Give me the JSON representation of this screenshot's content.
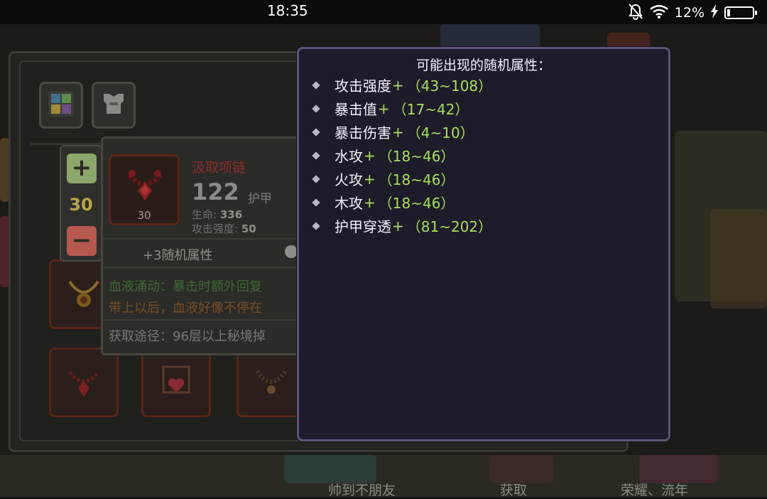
{
  "status_bar": {
    "time": "18:35",
    "battery_percent": "12%",
    "battery_level": 0.12,
    "icons": [
      "bell-off-icon",
      "wifi-icon",
      "charging-bolt-icon",
      "battery-icon"
    ]
  },
  "equipment_panel": {
    "tabs": [
      {
        "icon": "grid-inventory-icon"
      },
      {
        "icon": "armor-icon"
      }
    ],
    "slot_icons": [
      "necklace-gold-icon",
      "necklace-red-icon",
      "necklace-heart-icon",
      "necklace-bead-icon"
    ]
  },
  "stepper": {
    "plus": "+",
    "value": "30",
    "minus": "−"
  },
  "item_card": {
    "name": "汲取项链",
    "armor_value": "122",
    "armor_label": "护甲",
    "slot_count": "30",
    "stats": [
      {
        "label": "生命:",
        "value": "336"
      },
      {
        "label": "攻击强度:",
        "value": "50"
      }
    ],
    "random_attr_label": "+3随机属性",
    "effect_text": "血液涌动：暴击时额外回复",
    "flavor_text": "带上以后，血液好像不停在",
    "source_text": "获取途径：96层以上秘境掉"
  },
  "popup": {
    "title": "可能出现的随机属性：",
    "attributes": [
      {
        "name": "攻击强度",
        "plus": "+",
        "range": "（43~108）"
      },
      {
        "name": "暴击值",
        "plus": "+",
        "range": "（17~42）"
      },
      {
        "name": "暴击伤害",
        "plus": "+",
        "range": "（4~10）"
      },
      {
        "name": "水攻",
        "plus": "+",
        "range": "（18~46）"
      },
      {
        "name": "火攻",
        "plus": "+",
        "range": "（18~46）"
      },
      {
        "name": "木攻",
        "plus": "+",
        "range": "（18~46）"
      },
      {
        "name": "护甲穿透",
        "plus": "+",
        "range": "（81~202）"
      }
    ]
  },
  "background": {
    "bottom_labels": [
      "帅到不朋友",
      "获取",
      "荣耀、流年"
    ]
  },
  "colors": {
    "accent_green": "#a6e05a",
    "popup_bg": "#1e1b2b",
    "item_name_red": "#8e2f2b"
  }
}
